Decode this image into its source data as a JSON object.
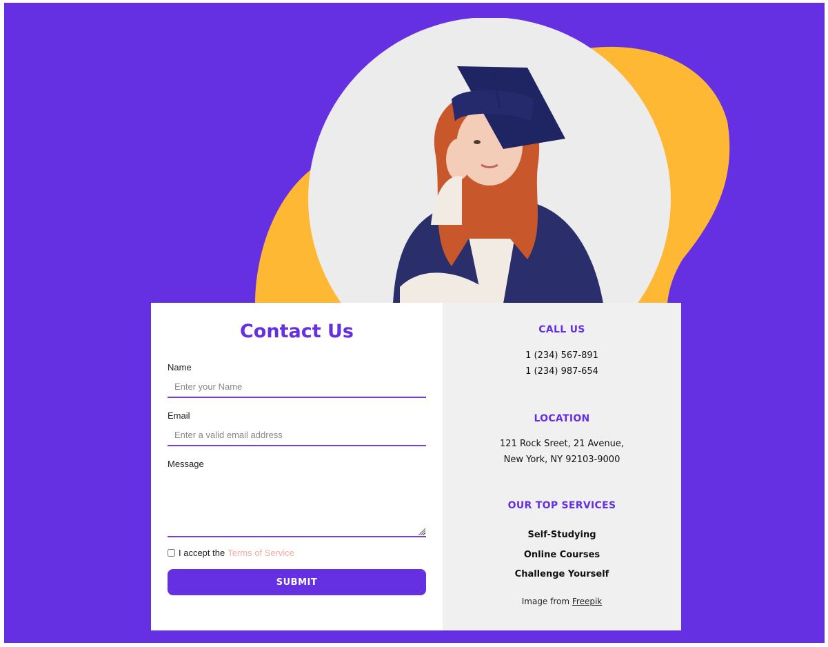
{
  "colors": {
    "brand_purple": "#6530e2",
    "accent_yellow": "#ffb833",
    "panel_gray": "#f0f0f1",
    "link_pink": "#f6a9a0"
  },
  "form": {
    "title": "Contact Us",
    "name_label": "Name",
    "name_placeholder": "Enter your Name",
    "email_label": "Email",
    "email_placeholder": "Enter a valid email address",
    "message_label": "Message",
    "terms_prefix": "I accept the",
    "terms_link": "Terms of Service",
    "terms_checked": false,
    "submit_label": "SUBMIT"
  },
  "info": {
    "call_heading": "CALL US",
    "phones": [
      "1 (234) 567-891",
      "1 (234) 987-654"
    ],
    "location_heading": "LOCATION",
    "address": [
      "121 Rock Sreet, 21 Avenue,",
      "New York, NY 92103-9000"
    ],
    "services_heading": "OUR TOP SERVICES",
    "services": [
      "Self-Studying",
      "Online Courses",
      "Challenge Yourself"
    ],
    "credit_prefix": "Image from",
    "credit_link": "Freepik"
  },
  "hero": {
    "icon": "graduate-student-photo"
  }
}
